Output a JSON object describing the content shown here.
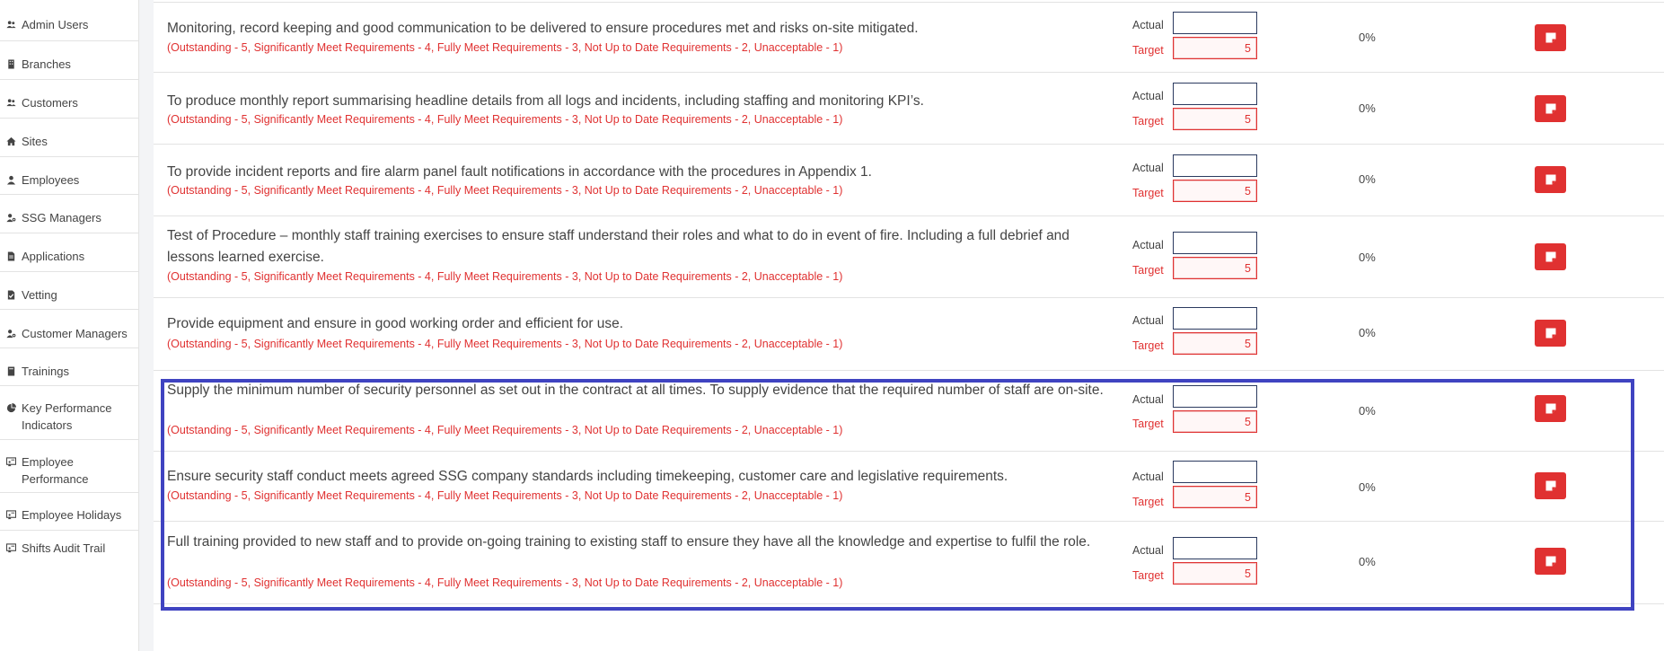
{
  "sidebar": {
    "items": [
      {
        "label": "Admin Users",
        "icon": "users-icon"
      },
      {
        "label": "Branches",
        "icon": "building-icon"
      },
      {
        "label": "Customers",
        "icon": "users-icon"
      },
      {
        "label": "Sites",
        "icon": "home-icon"
      },
      {
        "label": "Employees",
        "icon": "user-icon"
      },
      {
        "label": "SSG Managers",
        "icon": "user-gear-icon"
      },
      {
        "label": "Applications",
        "icon": "file-icon"
      },
      {
        "label": "Vetting",
        "icon": "file-check-icon"
      },
      {
        "label": "Customer Managers",
        "icon": "user-gear-icon"
      },
      {
        "label": "Trainings",
        "icon": "book-icon"
      },
      {
        "label": "Key Performance Indicators",
        "icon": "pie-chart-icon"
      },
      {
        "label": "Employee Performance",
        "icon": "chalkboard-icon"
      },
      {
        "label": "Employee Holidays",
        "icon": "chalkboard-icon"
      },
      {
        "label": "Shifts Audit Trail",
        "icon": "chalkboard-icon"
      }
    ]
  },
  "labels": {
    "actual": "Actual",
    "target": "Target"
  },
  "scale_text": "(Outstanding - 5, Significantly Meet Requirements - 4, Fully Meet Requirements - 3, Not Up to Date Requirements - 2, Unacceptable - 1)",
  "kpis": [
    {
      "description": "Monitoring, record keeping and good communication to be delivered to ensure procedures met and risks on-site mitigated.",
      "actual": "",
      "target": "5",
      "percent": "0%"
    },
    {
      "description": "To produce monthly report summarising headline details from all logs and incidents, including staffing and monitoring KPI’s.",
      "actual": "",
      "target": "5",
      "percent": "0%"
    },
    {
      "description": "To provide incident reports and fire alarm panel fault notifications in accordance with the procedures in Appendix 1.",
      "actual": "",
      "target": "5",
      "percent": "0%"
    },
    {
      "description": "Test of Procedure – monthly staff training exercises to ensure staff understand their roles and what to do in event of fire. Including a full debrief and lessons learned exercise.",
      "actual": "",
      "target": "5",
      "percent": "0%"
    },
    {
      "description": "Provide equipment and ensure in good working order and efficient for use.",
      "actual": "",
      "target": "5",
      "percent": "0%"
    },
    {
      "description": "Supply the minimum number of security personnel as set out in the contract at all times. To supply evidence that the required number of staff are on-site.",
      "actual": "",
      "target": "5",
      "percent": "0%"
    },
    {
      "description": "Ensure security staff conduct meets agreed SSG company standards including timekeeping, customer care and legislative requirements.",
      "actual": "",
      "target": "5",
      "percent": "0%"
    },
    {
      "description": "Full training provided to new staff and to provide on-going training to existing staff to ensure they have all the knowledge and expertise to fulfil the role.",
      "actual": "",
      "target": "5",
      "percent": "0%"
    }
  ],
  "colors": {
    "accent_red": "#e03131",
    "highlight_blue": "#3f43c1"
  }
}
